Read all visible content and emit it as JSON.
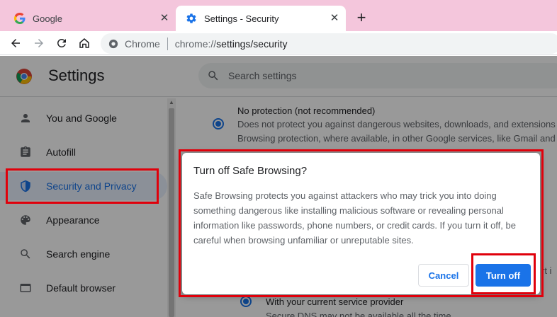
{
  "browser": {
    "tabs": [
      {
        "title": "Google",
        "active": false
      },
      {
        "title": "Settings - Security",
        "active": true
      }
    ],
    "omnibox": {
      "origin_label": "Chrome",
      "url_scheme": "chrome://",
      "url_path": "settings/security"
    }
  },
  "settings": {
    "title": "Settings",
    "search_placeholder": "Search settings",
    "sidebar_items": [
      {
        "label": "You and Google",
        "icon": "person-icon",
        "active": false
      },
      {
        "label": "Autofill",
        "icon": "clipboard-icon",
        "active": false
      },
      {
        "label": "Security and Privacy",
        "icon": "shield-icon",
        "active": true
      },
      {
        "label": "Appearance",
        "icon": "palette-icon",
        "active": false
      },
      {
        "label": "Search engine",
        "icon": "search-icon",
        "active": false
      },
      {
        "label": "Default browser",
        "icon": "browser-window-icon",
        "active": false
      }
    ],
    "content": {
      "no_protection_title": "No protection (not recommended)",
      "no_protection_desc_1": "Does not protect you against dangerous websites, downloads, and extensions",
      "no_protection_desc_2": "Browsing protection, where available, in other Google services, like Gmail and S",
      "partial_right_text": "rt i",
      "provider_title": "With your current service provider",
      "provider_desc": "Secure DNS may not be available all the time"
    }
  },
  "dialog": {
    "title": "Turn off Safe Browsing?",
    "body": "Safe Browsing protects you against attackers who may trick you into doing something dangerous like installing malicious software or revealing personal information like passwords, phone numbers, or credit cards. If you turn it off, be careful when browsing unfamiliar or unreputable sites.",
    "cancel_label": "Cancel",
    "confirm_label": "Turn off"
  },
  "colors": {
    "tab_strip": "#f4c6dc",
    "accent": "#1a73e8",
    "highlight": "#e0000b"
  }
}
